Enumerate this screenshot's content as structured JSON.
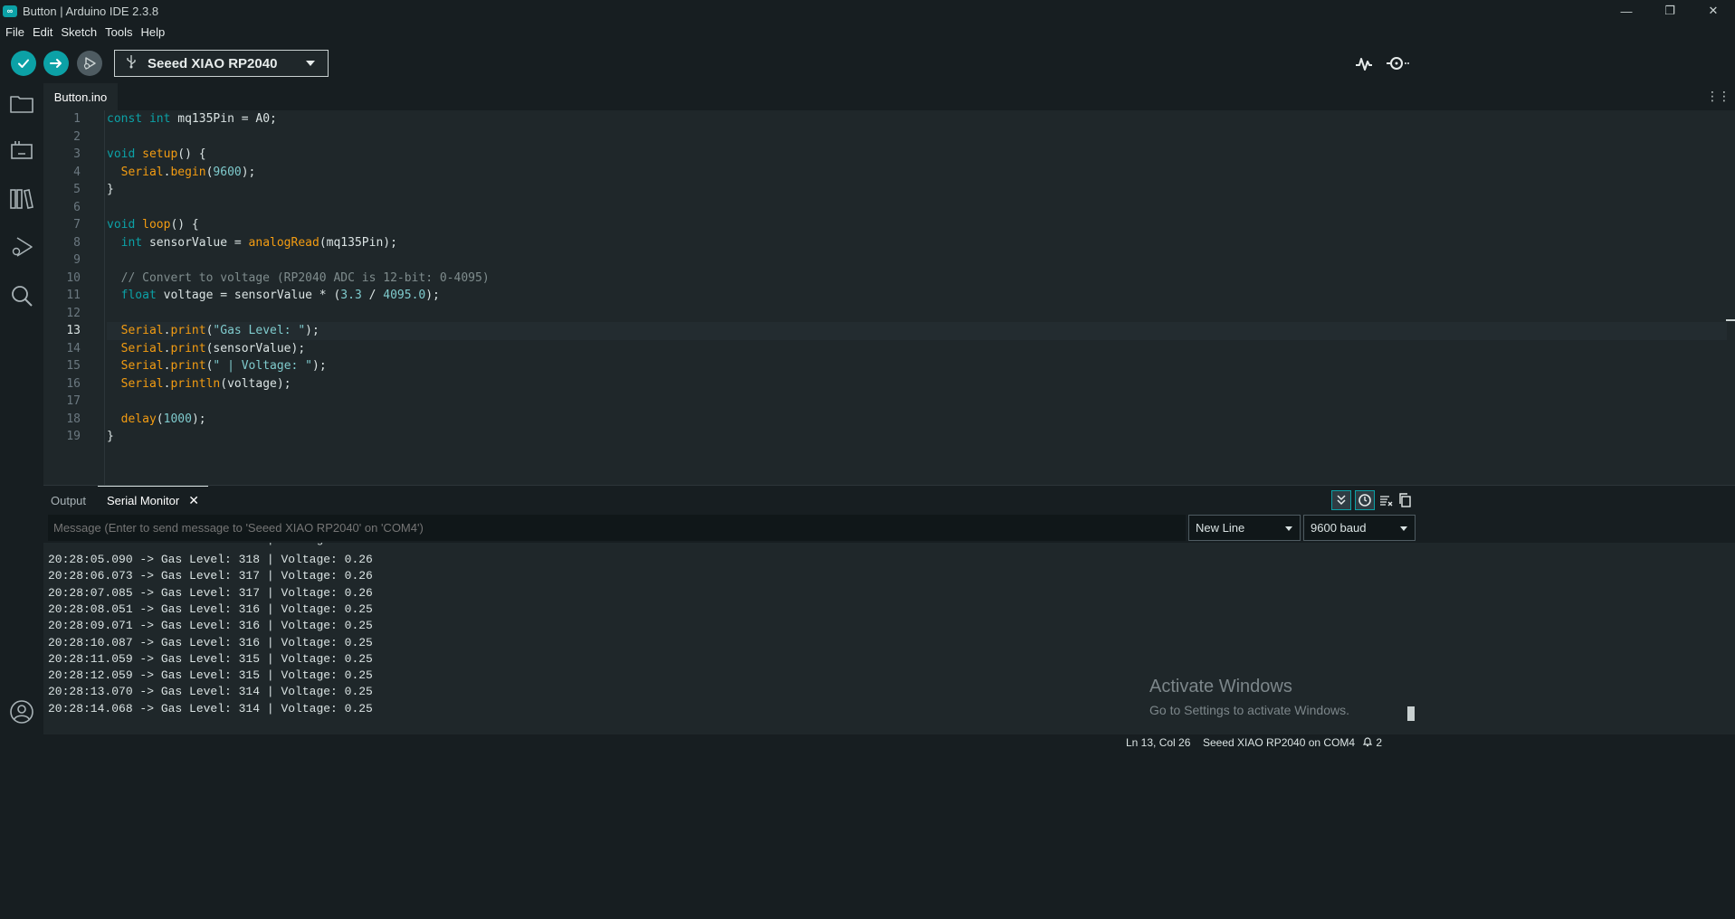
{
  "window": {
    "title": "Button | Arduino IDE 2.3.8",
    "logo_text": "∞",
    "minimize": "—",
    "maximize": "❐",
    "close": "✕"
  },
  "menu": [
    "File",
    "Edit",
    "Sketch",
    "Tools",
    "Help"
  ],
  "toolbar": {
    "board": "Seeed XIAO RP2040",
    "icons": [
      "verify-icon",
      "upload-icon",
      "debug-icon",
      "usb-icon",
      "serial-plotter-icon",
      "serial-monitor-icon"
    ]
  },
  "sidebar": {
    "icons": [
      "sketchbook-folder-icon",
      "boards-manager-icon",
      "library-manager-icon",
      "debug-icon",
      "search-icon",
      "profile-icon"
    ]
  },
  "editor": {
    "tab": "Button.ino",
    "more": "⋮⋮",
    "current_line": 13,
    "lines": [
      "1",
      "2",
      "3",
      "4",
      "5",
      "6",
      "7",
      "8",
      "9",
      "10",
      "11",
      "12",
      "13",
      "14",
      "15",
      "16",
      "17",
      "18",
      "19"
    ],
    "code": {
      "l1_kw": "const int",
      "l1_rest": " mq135Pin = A0;",
      "l3_kw": "void",
      "l3_fn": "setup",
      "l3_rest": "() {",
      "l4_obj": "  Serial",
      "l4_dot": ".",
      "l4_fn": "begin",
      "l4_open": "(",
      "l4_num": "9600",
      "l4_close": ");",
      "l5": "}",
      "l7_kw": "void",
      "l7_fn": "loop",
      "l7_rest": "() {",
      "l8_kw": "  int",
      "l8_mid": " sensorValue = ",
      "l8_fn": "analogRead",
      "l8_rest": "(mq135Pin);",
      "l10": "  // Convert to voltage (RP2040 ADC is 12-bit: 0-4095)",
      "l11_kw": "  float",
      "l11_mid": " voltage = sensorValue * (",
      "l11_n1": "3.3",
      "l11_sl": " / ",
      "l11_n2": "4095.0",
      "l11_end": ");",
      "l13_obj": "  Serial",
      "l13_fn": "print",
      "l13_str": "\"Gas Level: \"",
      "l14_obj": "  Serial",
      "l14_fn": "print",
      "l14_rest": "(sensorValue);",
      "l15_obj": "  Serial",
      "l15_fn": "print",
      "l15_str": "\" | Voltage: \"",
      "l16_obj": "  Serial",
      "l16_fn": "println",
      "l16_rest": "(voltage);",
      "l18_fn": "  delay",
      "l18_num": "1000",
      "l19": "}"
    }
  },
  "panel": {
    "tabs": {
      "output": "Output",
      "serial_monitor": "Serial Monitor",
      "close": "✕"
    },
    "message_placeholder": "Message (Enter to send message to 'Seeed XIAO RP2040' on 'COM4')",
    "line_ending": "New Line",
    "baud": "9600 baud",
    "icons": [
      "autoscroll-icon",
      "timestamp-icon",
      "clear-output-icon",
      "copy-output-icon"
    ],
    "output_lines": [
      "20:28:05.090 -> Gas Level: 318 | Voltage: 0.26",
      "20:28:06.073 -> Gas Level: 317 | Voltage: 0.26",
      "20:28:07.085 -> Gas Level: 317 | Voltage: 0.26",
      "20:28:08.051 -> Gas Level: 316 | Voltage: 0.25",
      "20:28:09.071 -> Gas Level: 316 | Voltage: 0.25",
      "20:28:10.087 -> Gas Level: 316 | Voltage: 0.25",
      "20:28:11.059 -> Gas Level: 315 | Voltage: 0.25",
      "20:28:12.059 -> Gas Level: 315 | Voltage: 0.25",
      "20:28:13.070 -> Gas Level: 314 | Voltage: 0.25",
      "20:28:14.068 -> Gas Level: 314 | Voltage: 0.25"
    ],
    "watermark_title": "Activate Windows",
    "watermark_sub": "Go to Settings to activate Windows."
  },
  "status": {
    "position": "Ln 13, Col 26",
    "board_port": "Seeed XIAO RP2040 on COM4",
    "notifications": "2"
  },
  "colors": {
    "accent": "#0ca1a6",
    "function": "#f39c12",
    "background": "#171e21",
    "editor_bg": "#1f272a"
  }
}
